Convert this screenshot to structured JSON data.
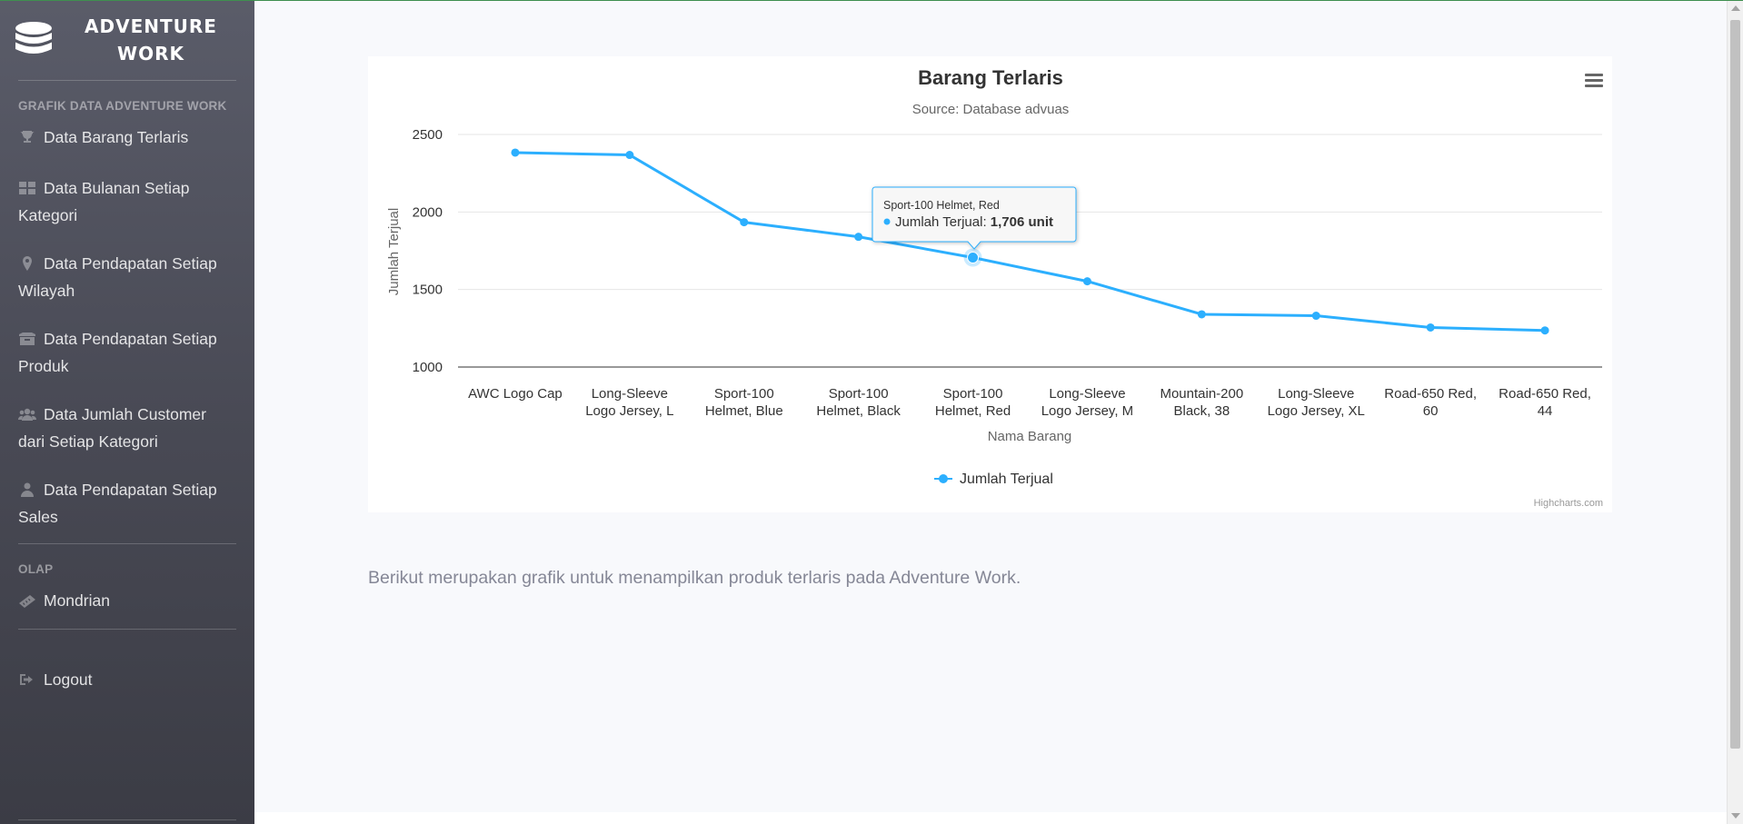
{
  "brand": {
    "line1": "ADVENTURE",
    "line2": "WORK",
    "icon": "database-icon"
  },
  "sidebar": {
    "heading_grafik": "GRAFIK DATA ADVENTURE WORK",
    "items": [
      {
        "label": "Data Barang Terlaris",
        "icon": "trophy-icon"
      },
      {
        "label": "Data Bulanan Setiap Kategori",
        "icon": "th-large-icon"
      },
      {
        "label": "Data Pendapatan Setiap Wilayah",
        "icon": "map-marker-icon"
      },
      {
        "label": "Data Pendapatan Setiap Produk",
        "icon": "box-icon"
      },
      {
        "label": "Data Jumlah Customer dari Setiap Kategori",
        "icon": "users-icon"
      },
      {
        "label": "Data Pendapatan Setiap Sales",
        "icon": "user-tie-icon"
      }
    ],
    "heading_olap": "OLAP",
    "olap_items": [
      {
        "label": "Mondrian",
        "icon": "ruler-icon"
      }
    ],
    "logout": {
      "label": "Logout",
      "icon": "sign-out-icon"
    }
  },
  "description": "Berikut merupakan grafik untuk menampilkan produk terlaris pada Adventure Work.",
  "credits": "Highcharts.com",
  "chart_menu_icon": "hamburger-menu-icon",
  "tooltip": {
    "header": "Sport-100 Helmet, Red",
    "series": "Jumlah Terjual",
    "value": "1,706 unit"
  },
  "colors": {
    "series": "#2caffe",
    "sidebar_top": "#5a5c69",
    "sidebar_bottom": "#3b3c45",
    "page_bg": "#f8f9fc",
    "grid": "#e6e6e6",
    "axis_line": "#333333"
  },
  "chart_data": {
    "type": "line",
    "title": "Barang Terlaris",
    "subtitle": "Source: Database advuas",
    "xlabel": "Nama Barang",
    "ylabel": "Jumlah Terjual",
    "categories": [
      [
        "AWC Logo Cap"
      ],
      [
        "Long-Sleeve",
        "Logo Jersey, L"
      ],
      [
        "Sport-100",
        "Helmet, Blue"
      ],
      [
        "Sport-100",
        "Helmet, Black"
      ],
      [
        "Sport-100",
        "Helmet, Red"
      ],
      [
        "Long-Sleeve",
        "Logo Jersey, M"
      ],
      [
        "Mountain-200",
        "Black, 38"
      ],
      [
        "Long-Sleeve",
        "Logo Jersey, XL"
      ],
      [
        "Road-650 Red,",
        "60"
      ],
      [
        "Road-650 Red,",
        "44"
      ]
    ],
    "series": [
      {
        "name": "Jumlah Terjual",
        "values": [
          2383,
          2368,
          1934,
          1840,
          1706,
          1553,
          1340,
          1331,
          1255,
          1236
        ]
      }
    ],
    "ylim": [
      1000,
      2500
    ],
    "yticks": [
      1000,
      1500,
      2000,
      2500
    ],
    "grid": true,
    "legend": "bottom-center",
    "highlighted_index": 4
  }
}
